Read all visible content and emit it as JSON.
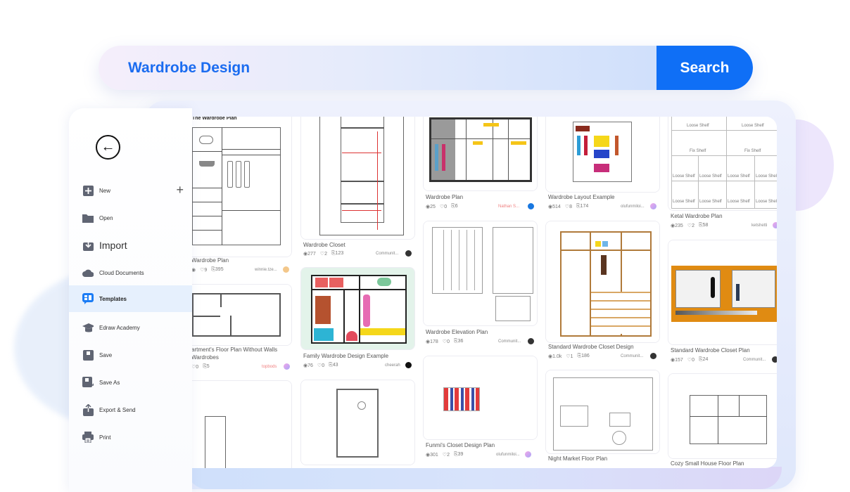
{
  "search": {
    "query": "Wardrobe Design",
    "button_label": "Search",
    "accent_color": "#0f6ff6"
  },
  "sidebar": {
    "back_icon": "arrow-left-circle-icon",
    "items": [
      {
        "label": "New",
        "icon": "new-file-icon",
        "extra": "+"
      },
      {
        "label": "Open",
        "icon": "folder-icon"
      },
      {
        "label": "Import",
        "icon": "import-icon"
      },
      {
        "label": "Cloud Documents",
        "icon": "cloud-icon"
      },
      {
        "label": "Templates",
        "icon": "templates-icon",
        "active": true
      },
      {
        "label": "Edraw Academy",
        "icon": "graduation-cap-icon"
      },
      {
        "label": "Save",
        "icon": "save-icon"
      },
      {
        "label": "Save As",
        "icon": "save-as-icon"
      },
      {
        "label": "Export & Send",
        "icon": "export-icon"
      },
      {
        "label": "Print",
        "icon": "printer-icon"
      }
    ]
  },
  "templates": [
    {
      "title": "Wardrobe Plan",
      "thumb_caption": "The Wardrobe Plan",
      "views": "",
      "likes": "9",
      "copies": "395",
      "author": "winnie.tze..."
    },
    {
      "title": "Wardrobe Closet",
      "views": "277",
      "likes": "2",
      "copies": "123",
      "author": "Communit..."
    },
    {
      "title": "Wardrobe Plan",
      "views": "25",
      "likes": "0",
      "copies": "6",
      "author": "Nathan S..."
    },
    {
      "title": "Wardrobe Layout Example",
      "views": "514",
      "likes": "8",
      "copies": "174",
      "author": "olufunmiloi..."
    },
    {
      "title": "Ketal Wardrobe Plan",
      "views": "235",
      "likes": "2",
      "copies": "58",
      "author": "ketshetti",
      "shelf_labels": [
        "Loose Shelf",
        "Fix Shelf"
      ]
    },
    {
      "title": "artment's Floor Plan Without Walls Wardrobes",
      "title_line1": "artment's Floor Plan Without Walls",
      "title_line2": "Wardrobes",
      "views": "",
      "likes": "0",
      "copies": "5",
      "author": "topbods"
    },
    {
      "title": "Family Wardrobe Design Example",
      "views": "76",
      "likes": "0",
      "copies": "43",
      "author": "cheerah"
    },
    {
      "title": "Wardrobe Elevation Plan",
      "views": "178",
      "likes": "0",
      "copies": "36",
      "author": "Communit..."
    },
    {
      "title": "Standard Wardrobe Closet Design",
      "views": "1.0k",
      "likes": "1",
      "copies": "186",
      "author": "Communit..."
    },
    {
      "title": "Standard Wardrobe Closet Plan",
      "views": "157",
      "likes": "0",
      "copies": "24",
      "author": "Communit..."
    },
    {
      "title": "",
      "views": "",
      "likes": "",
      "copies": "",
      "author": ""
    },
    {
      "title": "",
      "views": "",
      "likes": "",
      "copies": "",
      "author": ""
    },
    {
      "title": "Funmi's Closet Design Plan",
      "views": "301",
      "likes": "2",
      "copies": "39",
      "author": "olufunmiloi..."
    },
    {
      "title": "Night Market Floor Plan"
    },
    {
      "title": "Cozy Small House Floor Plan"
    }
  ],
  "icons": {
    "views": "◉",
    "likes": "♡",
    "copies": "⎘"
  }
}
